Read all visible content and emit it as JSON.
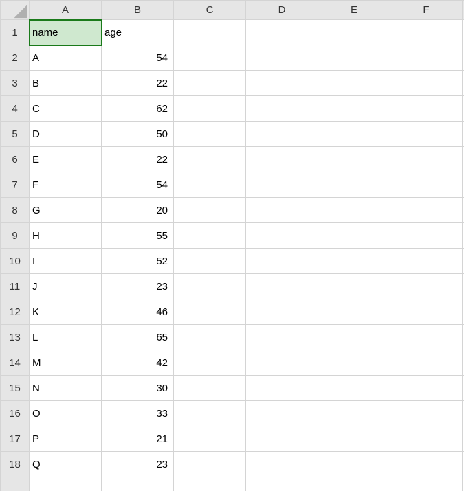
{
  "columns": [
    "A",
    "B",
    "C",
    "D",
    "E",
    "F"
  ],
  "row_count": 18,
  "active_cell": "A1",
  "headers": {
    "A1": "name",
    "B1": "age"
  },
  "rows": [
    {
      "name": "A",
      "age": 54
    },
    {
      "name": "B",
      "age": 22
    },
    {
      "name": "C",
      "age": 62
    },
    {
      "name": "D",
      "age": 50
    },
    {
      "name": "E",
      "age": 22
    },
    {
      "name": "F",
      "age": 54
    },
    {
      "name": "G",
      "age": 20
    },
    {
      "name": "H",
      "age": 55
    },
    {
      "name": "I",
      "age": 52
    },
    {
      "name": "J",
      "age": 23
    },
    {
      "name": "K",
      "age": 46
    },
    {
      "name": "L",
      "age": 65
    },
    {
      "name": "M",
      "age": 42
    },
    {
      "name": "N",
      "age": 30
    },
    {
      "name": "O",
      "age": 33
    },
    {
      "name": "P",
      "age": 21
    },
    {
      "name": "Q",
      "age": 23
    }
  ],
  "chart_data": {
    "type": "table",
    "columns": [
      "name",
      "age"
    ],
    "data": [
      [
        "A",
        54
      ],
      [
        "B",
        22
      ],
      [
        "C",
        62
      ],
      [
        "D",
        50
      ],
      [
        "E",
        22
      ],
      [
        "F",
        54
      ],
      [
        "G",
        20
      ],
      [
        "H",
        55
      ],
      [
        "I",
        52
      ],
      [
        "J",
        23
      ],
      [
        "K",
        46
      ],
      [
        "L",
        65
      ],
      [
        "M",
        42
      ],
      [
        "N",
        30
      ],
      [
        "O",
        33
      ],
      [
        "P",
        21
      ],
      [
        "Q",
        23
      ]
    ]
  }
}
